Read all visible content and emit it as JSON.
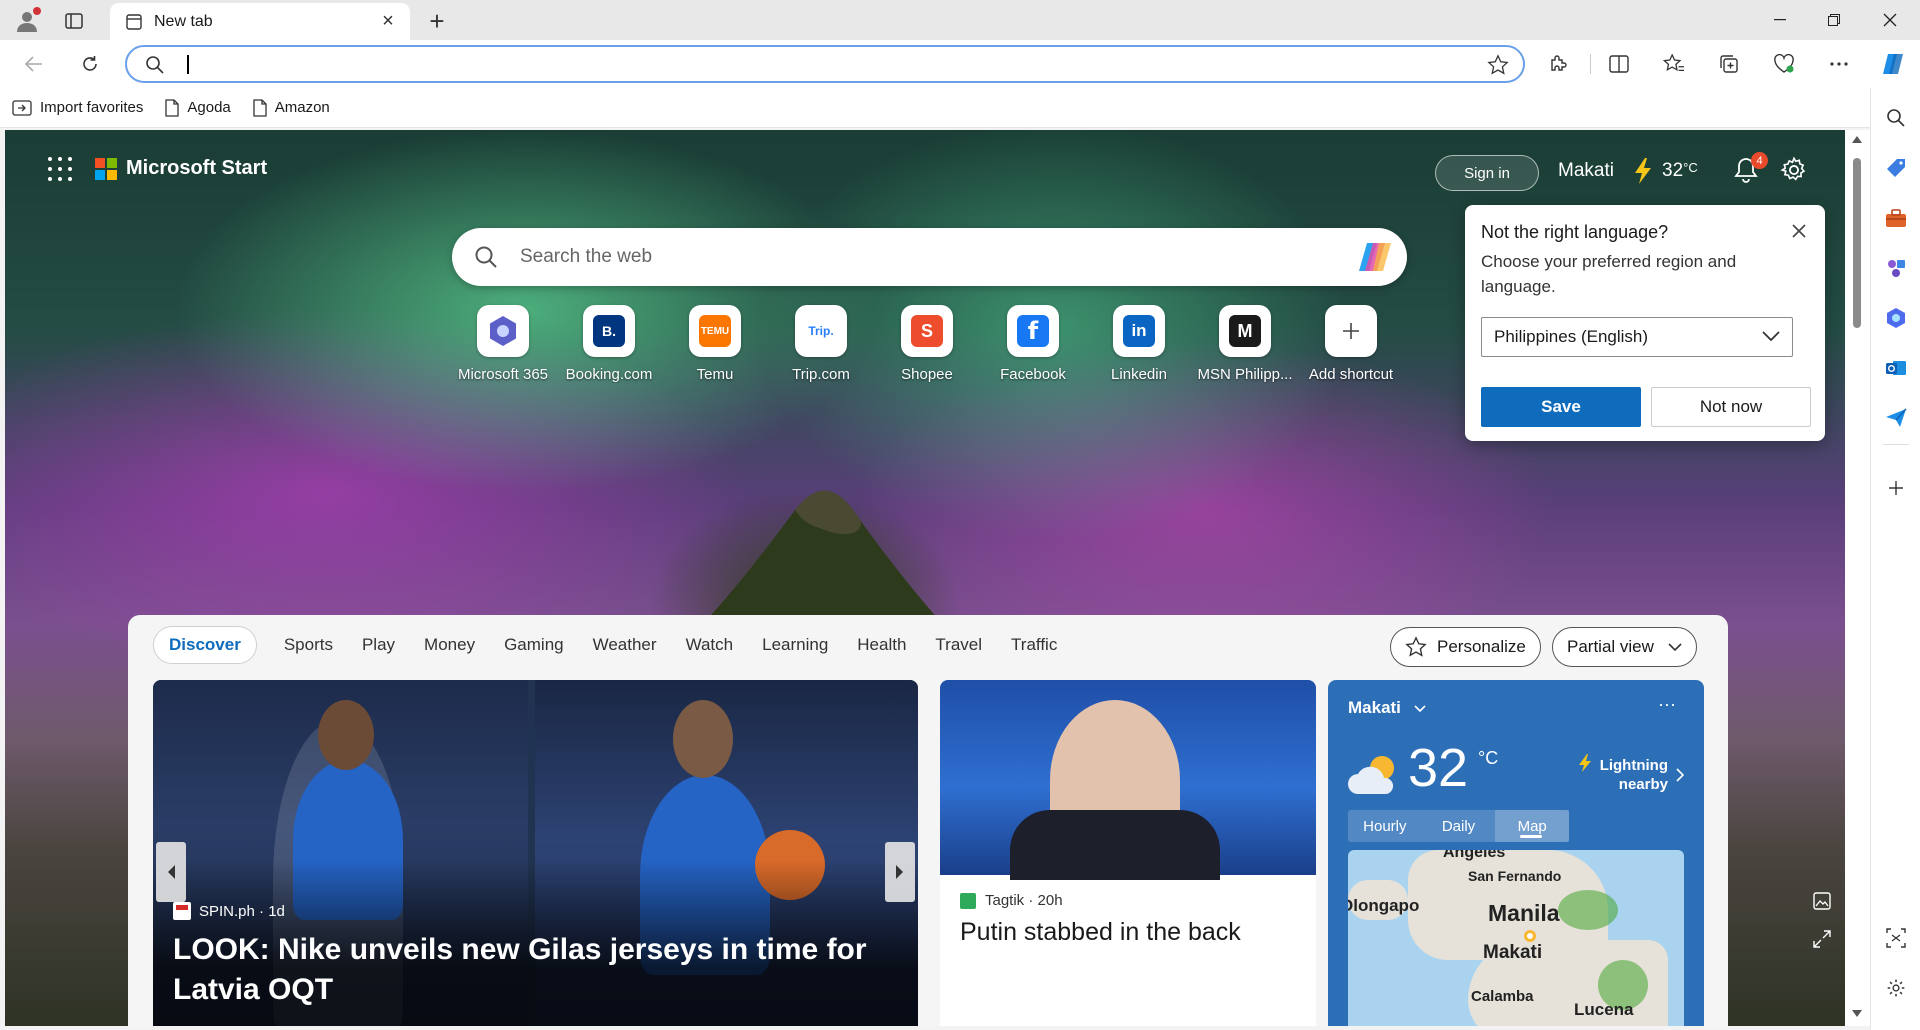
{
  "browser": {
    "tab_title": "New tab",
    "address_value": "",
    "favorites": [
      {
        "label": "Import favorites"
      },
      {
        "label": "Agoda"
      },
      {
        "label": "Amazon"
      }
    ]
  },
  "header": {
    "brand": "Microsoft Start",
    "sign_in": "Sign in",
    "location": "Makati",
    "temperature": "32",
    "temp_unit": "°C",
    "notification_count": "4"
  },
  "search": {
    "placeholder": "Search the web"
  },
  "shortcuts": [
    {
      "label": "Microsoft 365",
      "color": "#5b5fc7"
    },
    {
      "label": "Booking.com",
      "color": "#003580"
    },
    {
      "label": "Temu",
      "color": "#fb7701"
    },
    {
      "label": "Trip.com",
      "color": "#287dfa"
    },
    {
      "label": "Shopee",
      "color": "#ee4d2d"
    },
    {
      "label": "Facebook",
      "color": "#1877f2"
    },
    {
      "label": "Linkedin",
      "color": "#0a66c2"
    },
    {
      "label": "MSN Philipp...",
      "color": "#1a1a1a"
    },
    {
      "label": "Add shortcut",
      "color": "#ffffff"
    }
  ],
  "language_popup": {
    "title": "Not the right language?",
    "body": "Choose your preferred region and language.",
    "selected": "Philippines (English)",
    "save": "Save",
    "not_now": "Not now"
  },
  "feed": {
    "nav": [
      "Discover",
      "Sports",
      "Play",
      "Money",
      "Gaming",
      "Weather",
      "Watch",
      "Learning",
      "Health",
      "Travel",
      "Traffic"
    ],
    "personalize": "Personalize",
    "view": "Partial view",
    "hero": {
      "source": "SPIN.ph · 1d",
      "title": "LOOK: Nike unveils new Gilas jerseys in time for Latvia OQT"
    },
    "news": {
      "source": "Tagtik · 20h",
      "title": "Putin stabbed in the back"
    },
    "weather": {
      "city": "Makati",
      "temperature": "32",
      "unit": "°C",
      "alert_line1": "Lightning",
      "alert_line2": "nearby",
      "tabs": [
        "Hourly",
        "Daily",
        "Map"
      ],
      "map_labels": [
        "Angeles",
        "San Fernando",
        "Olongapo",
        "Manila",
        "Makati",
        "Calamba",
        "Lucena"
      ]
    }
  }
}
